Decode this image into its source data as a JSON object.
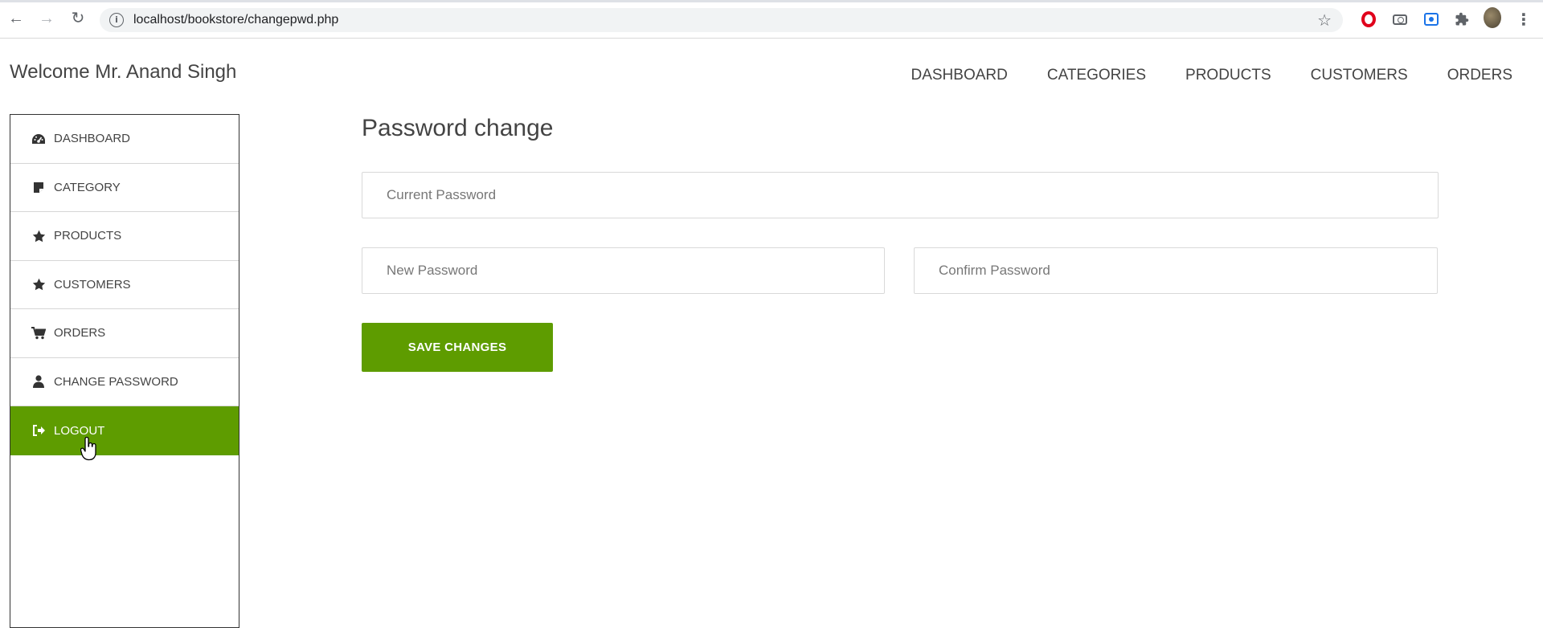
{
  "browser": {
    "url": "localhost/bookstore/changepwd.php"
  },
  "header": {
    "welcome": "Welcome Mr. Anand Singh",
    "nav": [
      "DASHBOARD",
      "CATEGORIES",
      "PRODUCTS",
      "CUSTOMERS",
      "ORDERS"
    ]
  },
  "sidebar": {
    "items": [
      {
        "label": "DASHBOARD",
        "icon": "dashboard-icon"
      },
      {
        "label": "CATEGORY",
        "icon": "sticky-note-icon"
      },
      {
        "label": "PRODUCTS",
        "icon": "star-icon"
      },
      {
        "label": "CUSTOMERS",
        "icon": "star-icon"
      },
      {
        "label": "ORDERS",
        "icon": "cart-icon"
      },
      {
        "label": "CHANGE PASSWORD",
        "icon": "user-icon"
      },
      {
        "label": "LOGOUT",
        "icon": "sign-out-icon",
        "active": true
      }
    ]
  },
  "main": {
    "title": "Password change",
    "current_password_placeholder": "Current Password",
    "new_password_placeholder": "New Password",
    "confirm_password_placeholder": "Confirm Password",
    "save_label": "SAVE CHANGES"
  },
  "colors": {
    "accent": "#5e9c00",
    "text": "#444444",
    "border": "#d9d9d9"
  }
}
